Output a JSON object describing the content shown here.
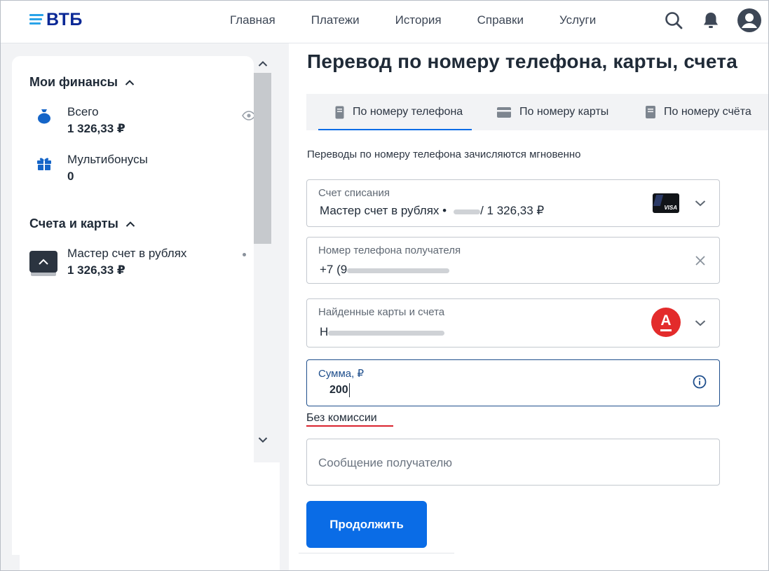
{
  "header": {
    "logo_text": "ВТБ",
    "nav": [
      "Главная",
      "Платежи",
      "История",
      "Справки",
      "Услуги"
    ]
  },
  "sidebar": {
    "finances_title": "Мои финансы",
    "total_label": "Всего",
    "total_value": "1 326,33 ₽",
    "bonus_label": "Мультибонусы",
    "bonus_value": "0",
    "accounts_title": "Счета и карты",
    "account_label": "Мастер счет в рублях",
    "account_value": "1 326,33 ₽"
  },
  "main": {
    "title": "Перевод по номеру телефона, карты, счета",
    "tabs": [
      "По номеру телефона",
      "По номеру карты",
      "По номеру счёта"
    ],
    "hint": "Переводы по номеру телефона зачисляются мгновенно",
    "account_field": {
      "label": "Счет списания",
      "value_prefix": "Мастер счет в рублях •",
      "value_suffix": "/ 1 326,33 ₽",
      "card_brand": "VISA"
    },
    "phone_field": {
      "label": "Номер телефона получателя",
      "value": "+7 (9"
    },
    "found_field": {
      "label": "Найденные карты и счета",
      "value": "Н",
      "bank_letter": "А"
    },
    "amount_field": {
      "label": "Сумма, ₽",
      "value": "200"
    },
    "fee_text": "Без комиссии",
    "message_placeholder": "Сообщение получателю",
    "continue_label": "Продолжить"
  },
  "colors": {
    "brand_blue": "#0a2896",
    "accent_blue": "#0a6ce6",
    "alfa_red": "#e32b2b",
    "underline_red": "#d9232e"
  }
}
